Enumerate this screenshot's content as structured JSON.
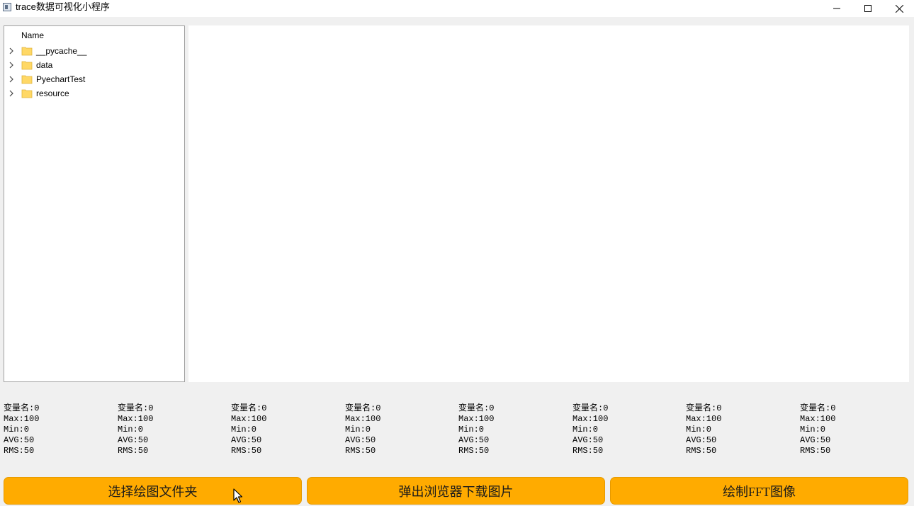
{
  "window": {
    "title": "trace数据可视化小程序"
  },
  "tree": {
    "header": "Name",
    "items": [
      {
        "label": "__pycache__"
      },
      {
        "label": "data"
      },
      {
        "label": "PyechartTest"
      },
      {
        "label": "resource"
      }
    ]
  },
  "stats": [
    {
      "name": "变量名:0",
      "max": "Max:100",
      "min": "Min:0",
      "avg": "AVG:50",
      "rms": "RMS:50"
    },
    {
      "name": "变量名:0",
      "max": "Max:100",
      "min": "Min:0",
      "avg": "AVG:50",
      "rms": "RMS:50"
    },
    {
      "name": "变量名:0",
      "max": "Max:100",
      "min": "Min:0",
      "avg": "AVG:50",
      "rms": "RMS:50"
    },
    {
      "name": "变量名:0",
      "max": "Max:100",
      "min": "Min:0",
      "avg": "AVG:50",
      "rms": "RMS:50"
    },
    {
      "name": "变量名:0",
      "max": "Max:100",
      "min": "Min:0",
      "avg": "AVG:50",
      "rms": "RMS:50"
    },
    {
      "name": "变量名:0",
      "max": "Max:100",
      "min": "Min:0",
      "avg": "AVG:50",
      "rms": "RMS:50"
    },
    {
      "name": "变量名:0",
      "max": "Max:100",
      "min": "Min:0",
      "avg": "AVG:50",
      "rms": "RMS:50"
    },
    {
      "name": "变量名:0",
      "max": "Max:100",
      "min": "Min:0",
      "avg": "AVG:50",
      "rms": "RMS:50"
    }
  ],
  "buttons": {
    "select_folder": "选择绘图文件夹",
    "open_browser": "弹出浏览器下载图片",
    "draw_fft": "绘制FFT图像"
  },
  "colors": {
    "button_bg": "#ffab00",
    "folder": "#ffd866"
  },
  "icons": {
    "app": "app-icon",
    "minimize": "minimize-icon",
    "maximize": "maximize-icon",
    "close": "close-icon",
    "folder": "folder-icon",
    "expand": "chevron-right-icon",
    "cursor": "mouse-cursor-icon"
  }
}
